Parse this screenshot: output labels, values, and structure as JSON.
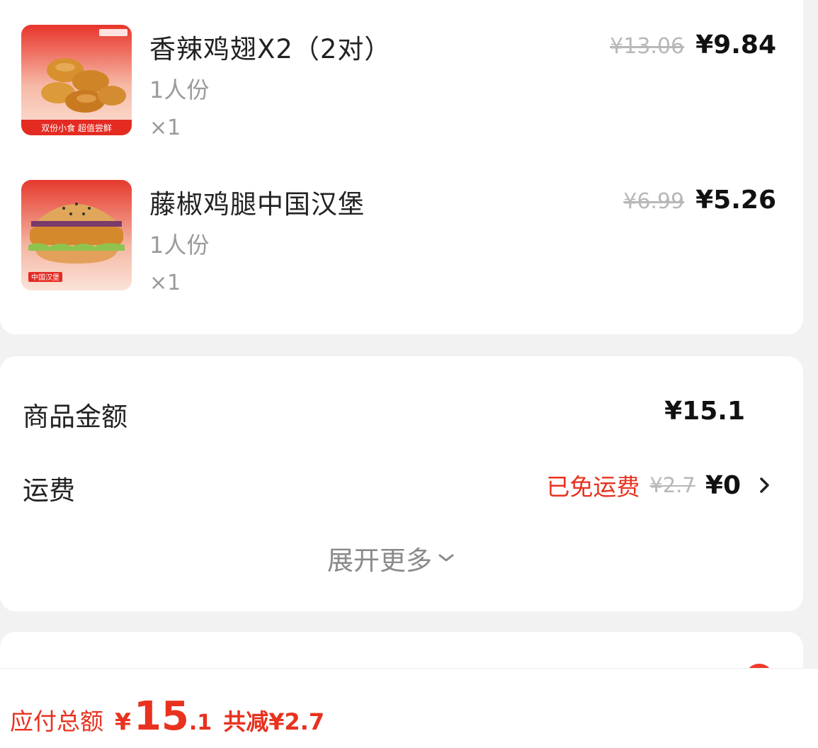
{
  "items": [
    {
      "name": "香辣鸡翅X2（2对）",
      "portion": "1人份",
      "quantity": "×1",
      "original_price": "¥13.06",
      "price": "¥9.84",
      "image": "spicy-chicken-wings-image",
      "badge_text": "双份小食  超值尝鲜"
    },
    {
      "name": "藤椒鸡腿中国汉堡",
      "portion": "1人份",
      "quantity": "×1",
      "original_price": "¥6.99",
      "price": "¥5.26",
      "image": "chicken-burger-image",
      "badge_text": "中国汉堡"
    }
  ],
  "summary": {
    "goods_label": "商品金额",
    "goods_value": "¥15.1",
    "shipping_label": "运费",
    "shipping_free_text": "已免运费",
    "shipping_original": "¥2.7",
    "shipping_value": "¥0",
    "expand_label": "展开更多"
  },
  "footer": {
    "total_label": "应付总额",
    "currency": "¥",
    "total_int": "15",
    "total_dec": ".1",
    "saved_text": "共减¥2.7"
  },
  "colors": {
    "accent_red": "#e8321f",
    "background": "#f2f2f2",
    "card": "#ffffff"
  }
}
